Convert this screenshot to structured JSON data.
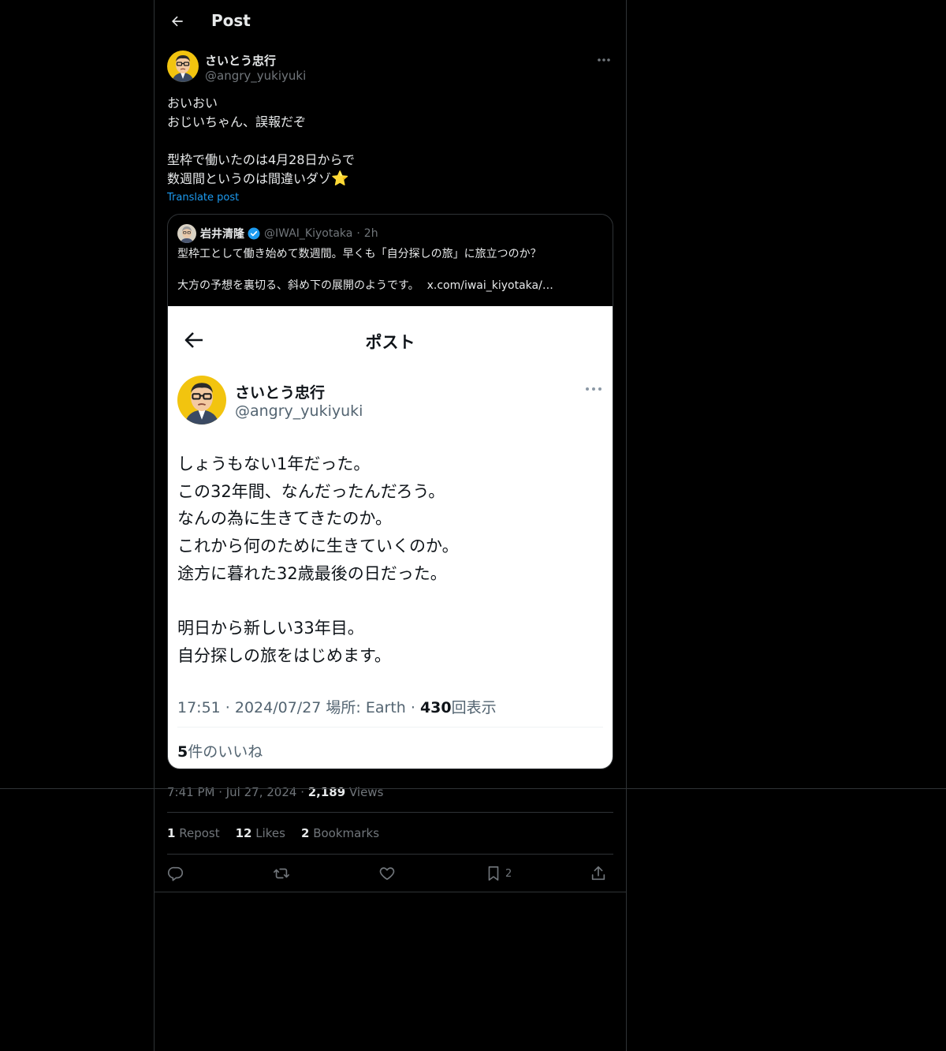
{
  "header": {
    "title": "Post"
  },
  "tweet": {
    "author_name": "さいとう忠行",
    "author_handle": "@angry_yukiyuki",
    "text_lines": [
      "おいおい",
      "おじいちゃん、誤報だぞ",
      "",
      "型枠で働いたのは4月28日からで",
      "数週間というのは間違いダゾ"
    ],
    "emoji": "⭐",
    "translate_label": "Translate post",
    "time": "7:41 PM · Jul 27, 2024",
    "views_count": "2,189",
    "views_label": "Views"
  },
  "quote": {
    "name": "岩井清隆",
    "handle": "@IWAI_Kiyotaka",
    "time": "2h",
    "line1": "型枠工として働き始めて数週間。早くも「自分探しの旅」に旅立つのか？",
    "line2": "大方の予想を裏切る、斜め下の展開のようです。",
    "link": "x.com/iwai_kiyotaka/…",
    "screenshot": {
      "title": "ポスト",
      "name": "さいとう忠行",
      "handle": "@angry_yukiyuki",
      "body_lines": [
        "しょうもない1年だった。",
        "この32年間、なんだったんだろう。",
        "なんの為に生きてきたのか。",
        "これから何のために生きていくのか。",
        "途方に暮れた32歳最後の日だった。",
        "",
        "明日から新しい33年目。",
        "自分探しの旅をはじめます。"
      ],
      "meta_prefix": "17:51 · 2024/07/27 場所: Earth · ",
      "meta_views": "430",
      "meta_suffix": "回表示",
      "likes_count": "5",
      "likes_label": "件のいいね"
    }
  },
  "stats": {
    "reposts_count": "1",
    "reposts_label": "Repost",
    "likes_count": "12",
    "likes_label": "Likes",
    "bookmarks_count": "2",
    "bookmarks_label": "Bookmarks"
  },
  "actions": {
    "bookmark_count": "2"
  },
  "icons": {
    "back": "arrow-left-icon",
    "more": "ellipsis-icon",
    "verified": "verified-badge-icon",
    "reply": "reply-icon",
    "repost": "repost-icon",
    "like": "heart-icon",
    "bookmark": "bookmark-icon",
    "share": "share-icon"
  },
  "colors": {
    "background": "#000000",
    "accent": "#1d9bf0",
    "muted": "#71767b",
    "border": "#2f3336",
    "verified": "#1d9bf0"
  }
}
